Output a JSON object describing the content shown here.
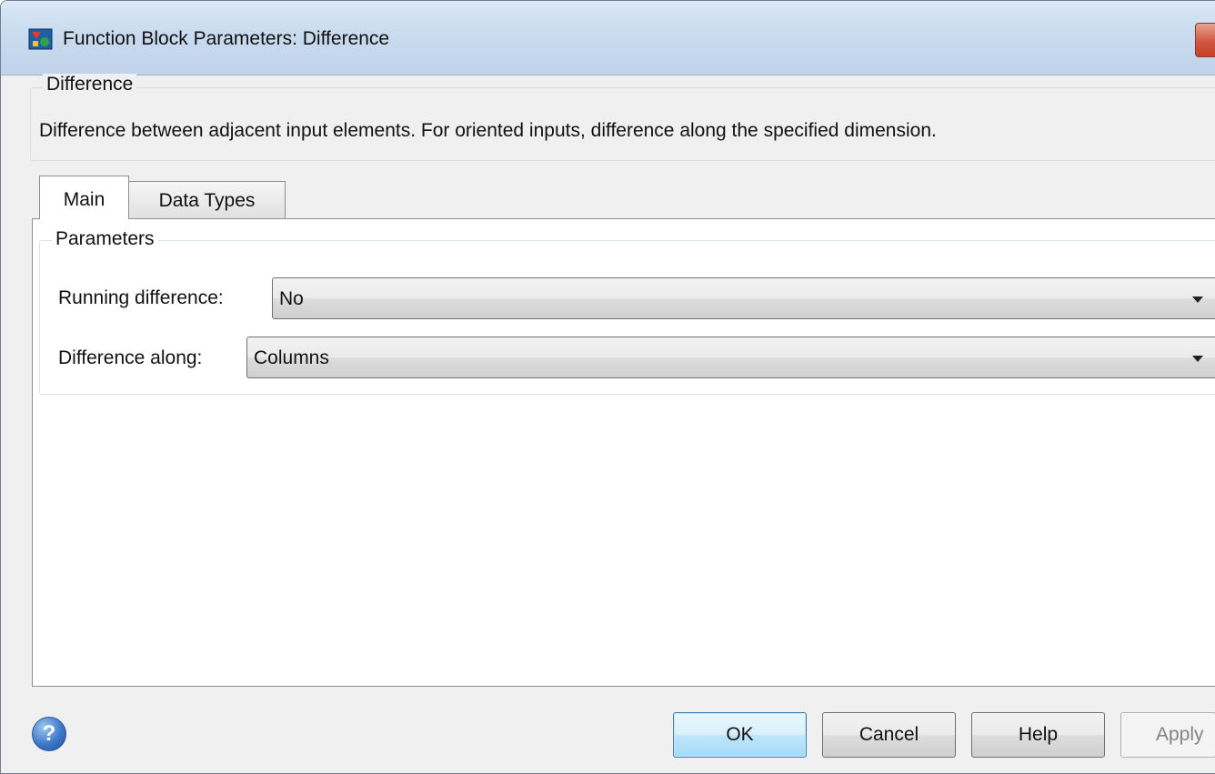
{
  "window": {
    "title": "Function Block Parameters: Difference"
  },
  "block": {
    "group_title": "Difference",
    "description": "Difference between adjacent input elements.  For oriented inputs, difference along the specified dimension."
  },
  "tabs": [
    {
      "label": "Main",
      "selected": true
    },
    {
      "label": "Data Types",
      "selected": false
    }
  ],
  "parameters": {
    "group_title": "Parameters",
    "running_difference": {
      "label": "Running difference:",
      "value": "No"
    },
    "difference_along": {
      "label": "Difference along:",
      "value": "Columns"
    }
  },
  "buttons": {
    "ok": "OK",
    "cancel": "Cancel",
    "help": "Help",
    "apply": "Apply"
  },
  "icons": {
    "app": "simulink-block-icon",
    "help": "help-icon",
    "close": "close-icon"
  },
  "colors": {
    "titlebar": "#c9dbef",
    "ok_border": "#3c7fb1",
    "close": "#d0573e"
  }
}
